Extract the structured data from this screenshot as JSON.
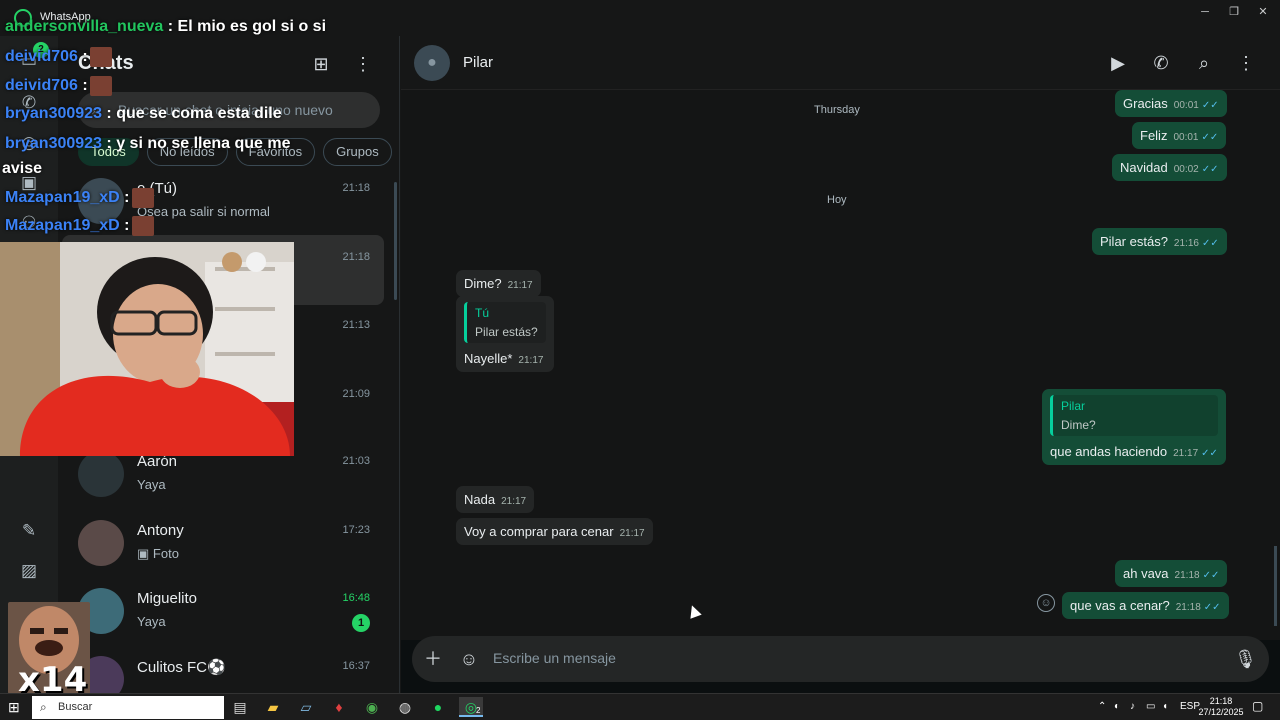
{
  "window": {
    "title": "WhatsApp",
    "minimize": "─",
    "maximize": "❐",
    "close": "✕"
  },
  "rail": {
    "badge": "2"
  },
  "chat_list": {
    "title": "Chats",
    "new_chat_icon": "new-chat-icon",
    "menu_icon": "kebab-menu-icon",
    "search_placeholder": "Buscar un chat o iniciar uno nuevo",
    "filters": [
      "Todos",
      "No leídos",
      "Favoritos",
      "Grupos"
    ],
    "chats": [
      {
        "name": "o (Tú)",
        "message": "Ósea pa  salir si normal",
        "time": "21:18"
      },
      {
        "name": "",
        "message": "",
        "time": "21:18"
      },
      {
        "name": "",
        "message": "",
        "time": "21:13"
      },
      {
        "name": "",
        "message": "",
        "time": "21:09"
      },
      {
        "name": "Aarón",
        "message": "Yaya",
        "time": "21:03"
      },
      {
        "name": "Antony",
        "message": "Foto",
        "time": "17:23"
      },
      {
        "name": "Miguelito",
        "message": "Yaya",
        "time": "16:48",
        "unread": "1"
      },
      {
        "name": "Culitos FC⚽",
        "message": "",
        "time": "16:37"
      }
    ]
  },
  "conversation": {
    "contact_name": "Pilar",
    "day_separators": [
      "Thursday",
      "Hoy"
    ],
    "messages": [
      {
        "dir": "out",
        "text": "Gracias",
        "time": "00:01"
      },
      {
        "dir": "out",
        "text": "Feliz",
        "time": "00:01"
      },
      {
        "dir": "out",
        "text": "Navidad",
        "time": "00:02"
      },
      {
        "dir": "out",
        "text": "Pilar estás?",
        "time": "21:16"
      },
      {
        "dir": "in",
        "text": "Dime?",
        "time": "21:17"
      },
      {
        "dir": "in",
        "quote_author": "Tú",
        "quote_text": "Pilar estás?",
        "text": "Nayelle*",
        "time": "21:17"
      },
      {
        "dir": "out",
        "quote_author": "Pilar",
        "quote_text": "Dime?",
        "text": "que andas haciendo",
        "time": "21:17"
      },
      {
        "dir": "in",
        "text": "Nada",
        "time": "21:17"
      },
      {
        "dir": "in",
        "text": "Voy a comprar para cenar",
        "time": "21:17"
      },
      {
        "dir": "out",
        "text": "ah vava",
        "time": "21:18"
      },
      {
        "dir": "out",
        "text": "que vas a cenar?",
        "time": "21:18"
      }
    ],
    "composer_placeholder": "Escribe un mensaje"
  },
  "stream_overlay": {
    "chat_lines": [
      {
        "user": "andersonvilla_nueva",
        "text": ": El mio es gol si o si",
        "green": true
      },
      {
        "user": "deivid706",
        "text": ":",
        "emote": true
      },
      {
        "user": "deivid706",
        "text": ":",
        "emote": true
      },
      {
        "user": "bryan300923",
        "text": ": que se coma esta dile"
      },
      {
        "user": "bryan300923",
        "text": ": y si no se llena que me"
      },
      {
        "user": "",
        "text": "avise"
      },
      {
        "user": "Mazapan19_xD",
        "text": ":",
        "emote": true
      },
      {
        "user": "Mazapan19_xD",
        "text": ":",
        "emote": true
      }
    ],
    "multiplier": "x14"
  },
  "taskbar": {
    "search_placeholder": "Buscar",
    "language": "ESP",
    "time": "21:18",
    "date": "27/12/2025",
    "whatsapp_badge": "2"
  },
  "colors": {
    "accent": "#25d366",
    "outgoing_bubble": "#144d37",
    "incoming_bubble": "#242626",
    "read_ticks": "#53bdeb"
  }
}
